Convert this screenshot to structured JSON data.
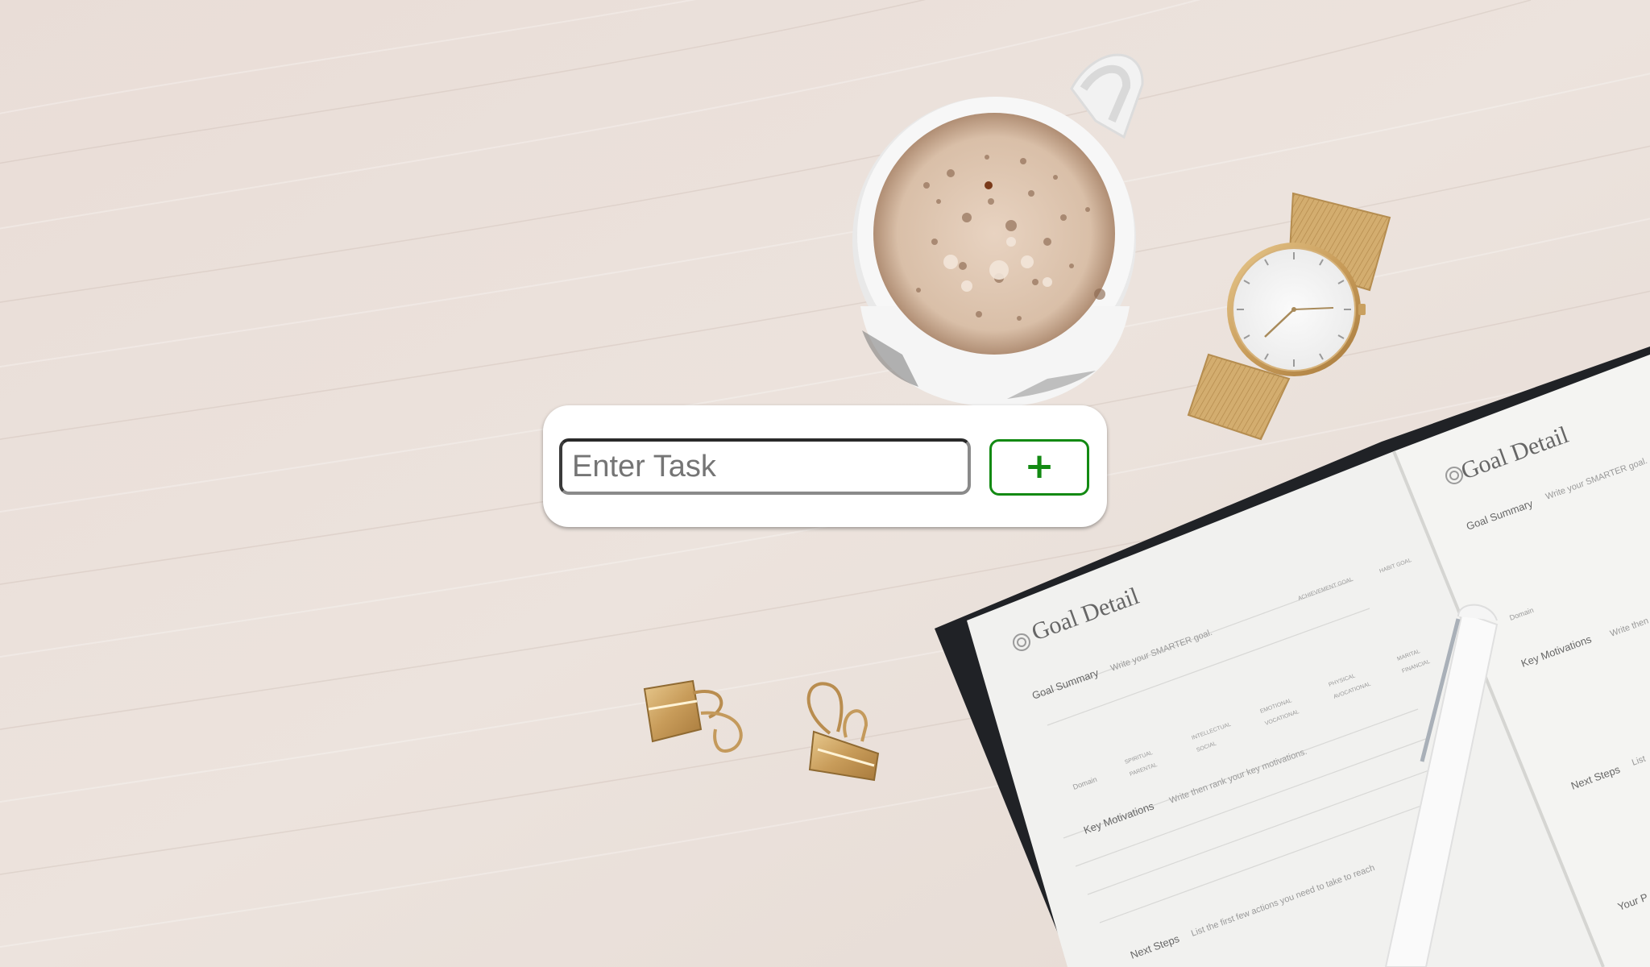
{
  "task_form": {
    "input_placeholder": "Enter Task",
    "input_value": "",
    "add_button_label": "+"
  },
  "background": {
    "scene": "desk-flat-lay",
    "planner_heading": "Goal Detail",
    "planner_section_1": "Goal Summary",
    "planner_hint_1": "Write your SMARTER goal.",
    "planner_section_2": "Key Motivations",
    "planner_hint_2": "Write then rank your key motivations.",
    "planner_section_3": "Next Steps",
    "planner_hint_3": "List the first few actions you need to take to reach",
    "planner_domain": "Domain",
    "planner_checkbox_1": "ACHIEVEMENT GOAL",
    "planner_checkbox_2": "HABIT GOAL",
    "planner_checkbox_3": "SPIRITUAL",
    "planner_checkbox_4": "PARENTAL",
    "planner_checkbox_5": "INTELLECTUAL",
    "planner_checkbox_6": "SOCIAL",
    "planner_checkbox_7": "EMOTIONAL",
    "planner_checkbox_8": "VOCATIONAL",
    "planner_checkbox_9": "PHYSICAL",
    "planner_checkbox_10": "AVOCATIONAL",
    "planner_checkbox_11": "MARITAL",
    "planner_checkbox_12": "FINANCIAL",
    "planner_right_heading": "Goal Detail",
    "planner_right_section_1": "Goal Summary",
    "planner_right_hint_1": "Write your SMARTER goal.",
    "planner_right_domain": "Domain",
    "planner_right_section_2": "Key Motivations",
    "planner_right_hint_2": "Write then",
    "planner_right_section_3": "Next Steps",
    "planner_right_hint_3": "List",
    "planner_right_section_4": "Your P",
    "colors": {
      "wood": "#ebe1db",
      "button_accent": "#138a13"
    }
  }
}
